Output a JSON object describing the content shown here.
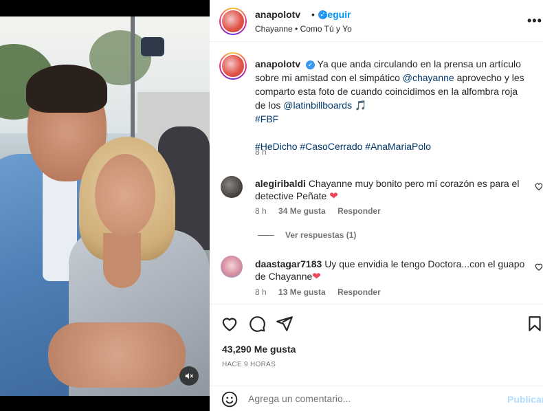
{
  "colors": {
    "accent": "#0095f6",
    "link": "#00376b",
    "heart": "#ed4956",
    "verified": "#3897f0",
    "muted": "#737373",
    "publish_disabled": "#b3dbff"
  },
  "header": {
    "username": "anapolotv",
    "follow_label": "Seguir",
    "separator": "•",
    "subtitle": "Chayanne • Como Tú y Yo",
    "more_icon": "more-horizontal-icon"
  },
  "caption": {
    "username": "anapolotv",
    "text_1": "Ya que anda circulando en la prensa un artículo sobre mi amistad con el simpático",
    "mention_1": "@chayanne",
    "text_2": "aprovecho y les comparto esta foto de cuando coincidimos en la alfombra roja de los",
    "mention_2": "@latinbillboards",
    "emoji": "🎵",
    "hashtag_1": "#FBF",
    "hashtags_2": "#HeDicho #CasoCerrado #AnaMariaPolo",
    "time": "8 h"
  },
  "comments": [
    {
      "username": "alegiribaldi",
      "text": "Chayanne muy bonito pero mí corazón es para el detective Peñate",
      "emoji": "❤",
      "time": "8 h",
      "likes": "34 Me gusta",
      "reply": "Responder"
    },
    {
      "username": "daastagar7183",
      "text": "Uy que envidia le tengo Doctora...con el guapo de Chayanne",
      "emoji": "❤",
      "time": "8 h",
      "likes": "13 Me gusta",
      "reply": "Responder"
    }
  ],
  "view_replies": "Ver respuestas (1)",
  "actions": {
    "icons": [
      "heart-icon",
      "comment-icon",
      "share-icon",
      "bookmark-icon"
    ],
    "likes": "43,290 Me gusta",
    "ago": "HACE 9 HORAS"
  },
  "comment_box": {
    "placeholder": "Agrega un comentario...",
    "publish_label": "Publicar"
  },
  "media": {
    "mute_icon": "volume-muted-icon"
  }
}
